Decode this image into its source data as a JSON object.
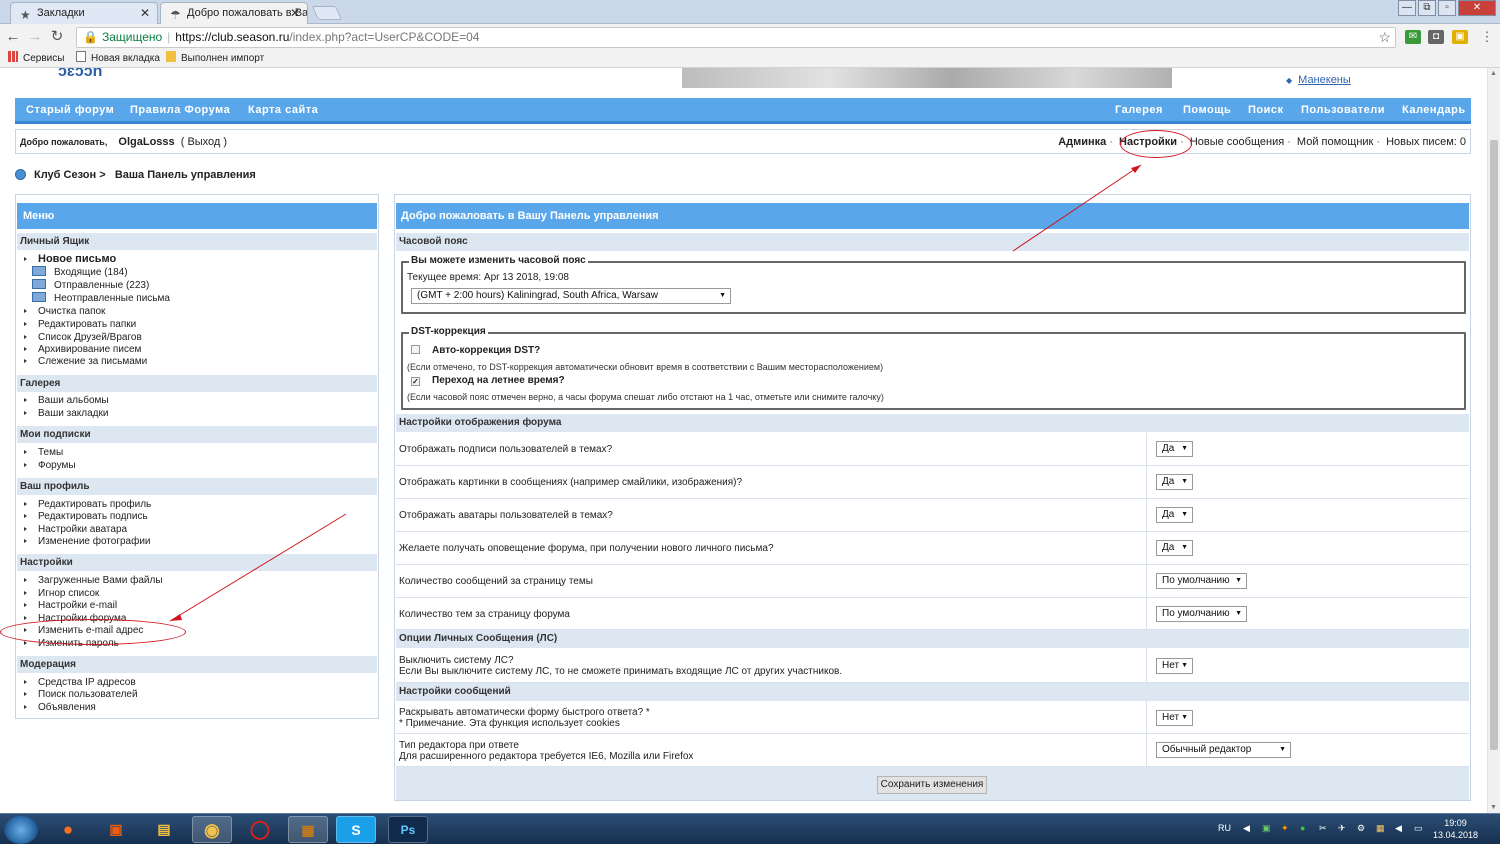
{
  "browser": {
    "tabs": [
      {
        "title": "Закладки",
        "icon": "star-icon",
        "active": false
      },
      {
        "title": "Добро пожаловать в Ва",
        "icon": "page-icon",
        "active": true
      }
    ],
    "address": {
      "secure_label": "Защищено",
      "host": "https://club.season.ru",
      "path": "/index.php?act=UserCP&CODE=04"
    },
    "bookmarks": [
      "Сервисы",
      "Новая вкладка",
      "Выполнен импорт"
    ]
  },
  "site": {
    "logo_text": "ɔɛɔɔn",
    "side_link": "Манекены",
    "nav_left": [
      "Старый форум",
      "Правила Форума",
      "Карта сайта"
    ],
    "nav_right": [
      "Галерея",
      "Помощь",
      "Поиск",
      "Пользователи",
      "Календарь"
    ],
    "userbar": {
      "welcome": "Добро пожаловать,",
      "nickname": "OlgaLosss",
      "logout": "( Выход )",
      "admin": "Админка",
      "settings": "Настройки",
      "new_posts": "Новые сообщения",
      "assistant": "Мой помощник",
      "new_letters": "Новых писем: 0"
    },
    "breadcrumb": [
      "Клуб Сезон",
      "Ваша Панель управления"
    ]
  },
  "sidebar": {
    "title": "Меню",
    "sections": [
      {
        "title": "Личный Ящик",
        "items": [
          {
            "label": "Новое письмо",
            "bold": true,
            "type": "bullet"
          },
          {
            "label": "Входящие (184)",
            "type": "folder"
          },
          {
            "label": "Отправленные (223)",
            "type": "folder"
          },
          {
            "label": "Неотправленные письма",
            "type": "folder"
          },
          {
            "label": "Очистка папок",
            "type": "bullet"
          },
          {
            "label": "Редактировать папки",
            "type": "bullet"
          },
          {
            "label": "Список Друзей/Врагов",
            "type": "bullet"
          },
          {
            "label": "Архивирование писем",
            "type": "bullet"
          },
          {
            "label": "Слежение за письмами",
            "type": "bullet"
          }
        ]
      },
      {
        "title": "Галерея",
        "items": [
          {
            "label": "Ваши альбомы",
            "type": "bullet"
          },
          {
            "label": "Ваши закладки",
            "type": "bullet"
          }
        ]
      },
      {
        "title": "Мои подписки",
        "items": [
          {
            "label": "Темы",
            "type": "bullet"
          },
          {
            "label": "Форумы",
            "type": "bullet"
          }
        ]
      },
      {
        "title": "Ваш профиль",
        "items": [
          {
            "label": "Редактировать профиль",
            "type": "bullet"
          },
          {
            "label": "Редактировать подпись",
            "type": "bullet"
          },
          {
            "label": "Настройки аватара",
            "type": "bullet"
          },
          {
            "label": "Изменение фотографии",
            "type": "bullet"
          }
        ]
      },
      {
        "title": "Настройки",
        "items": [
          {
            "label": "Загруженные Вами файлы",
            "type": "bullet"
          },
          {
            "label": "Игнор список",
            "type": "bullet"
          },
          {
            "label": "Настройки e-mail",
            "type": "bullet"
          },
          {
            "label": "Настройки форума",
            "type": "bullet"
          },
          {
            "label": "Изменить e-mail адрес",
            "type": "bullet"
          },
          {
            "label": "Изменить пароль",
            "type": "bullet"
          }
        ]
      },
      {
        "title": "Модерация",
        "items": [
          {
            "label": "Средства IP адресов",
            "type": "bullet"
          },
          {
            "label": "Поиск пользователей",
            "type": "bullet"
          },
          {
            "label": "Объявления",
            "type": "bullet"
          }
        ]
      }
    ]
  },
  "main": {
    "title": "Добро пожаловать в Вашу Панель управления",
    "timezone": {
      "section": "Часовой пояс",
      "legend": "Вы можете изменить часовой пояс",
      "current_time": "Текущее время: Apr 13 2018, 19:08",
      "selected": "(GMT + 2:00 hours) Kaliningrad, South Africa, Warsaw"
    },
    "dst": {
      "legend": "DST-коррекция",
      "auto_label": "Авто-коррекция DST?",
      "auto_checked": false,
      "auto_note": "(Если отмечено, то DST-коррекция автоматически обновит время в соответствии с Вашим месторасположением)",
      "summer_label": "Переход на летнее время?",
      "summer_checked": true,
      "summer_note": "(Если часовой пояс отмечен верно, а часы форума спешат либо отстают на 1 час, отметьте или снимите галочку)"
    },
    "display": {
      "section": "Настройки отображения форума",
      "rows": [
        {
          "q": "Отображать подписи пользователей в темах?",
          "value": "Да"
        },
        {
          "q": "Отображать картинки в сообщениях (например смайлики, изображения)?",
          "value": "Да"
        },
        {
          "q": "Отображать аватары пользователей в темах?",
          "value": "Да"
        },
        {
          "q": "Желаете получать оповещение форума, при получении нового личного письма?",
          "value": "Да"
        },
        {
          "q": "Количество сообщений за страницу темы",
          "value": "По умолчанию"
        },
        {
          "q": "Количество тем за страницу форума",
          "value": "По умолчанию"
        }
      ]
    },
    "pm": {
      "section": "Опции Личных Сообщения (ЛС)",
      "q": "Выключить систему ЛС?",
      "note": "Если Вы выключите систему ЛС, то не сможете принимать входящие ЛС от других участников.",
      "value": "Нет"
    },
    "messages": {
      "section": "Настройки сообщений",
      "quick_q": "Раскрывать автоматически форму быстрого ответа? *",
      "quick_note": "* Примечание. Эта функция использует cookies",
      "quick_value": "Нет",
      "editor_q": "Тип редактора при ответе",
      "editor_note": "Для расширенного редактора требуется IE6, Mozilla или Firefox",
      "editor_value": "Обычный редактор"
    },
    "save_label": "Сохранить изменения"
  },
  "taskbar": {
    "lang": "RU",
    "time": "19:09",
    "date": "13.04.2018",
    "apps": [
      "firefox-icon",
      "ms-office-icon",
      "file-explorer-icon",
      "chrome-icon",
      "opera-icon",
      "winrar-icon",
      "skype-icon",
      "photoshop-icon"
    ]
  },
  "annotation_color": "#d0141e",
  "accent": "#5aa6ea"
}
